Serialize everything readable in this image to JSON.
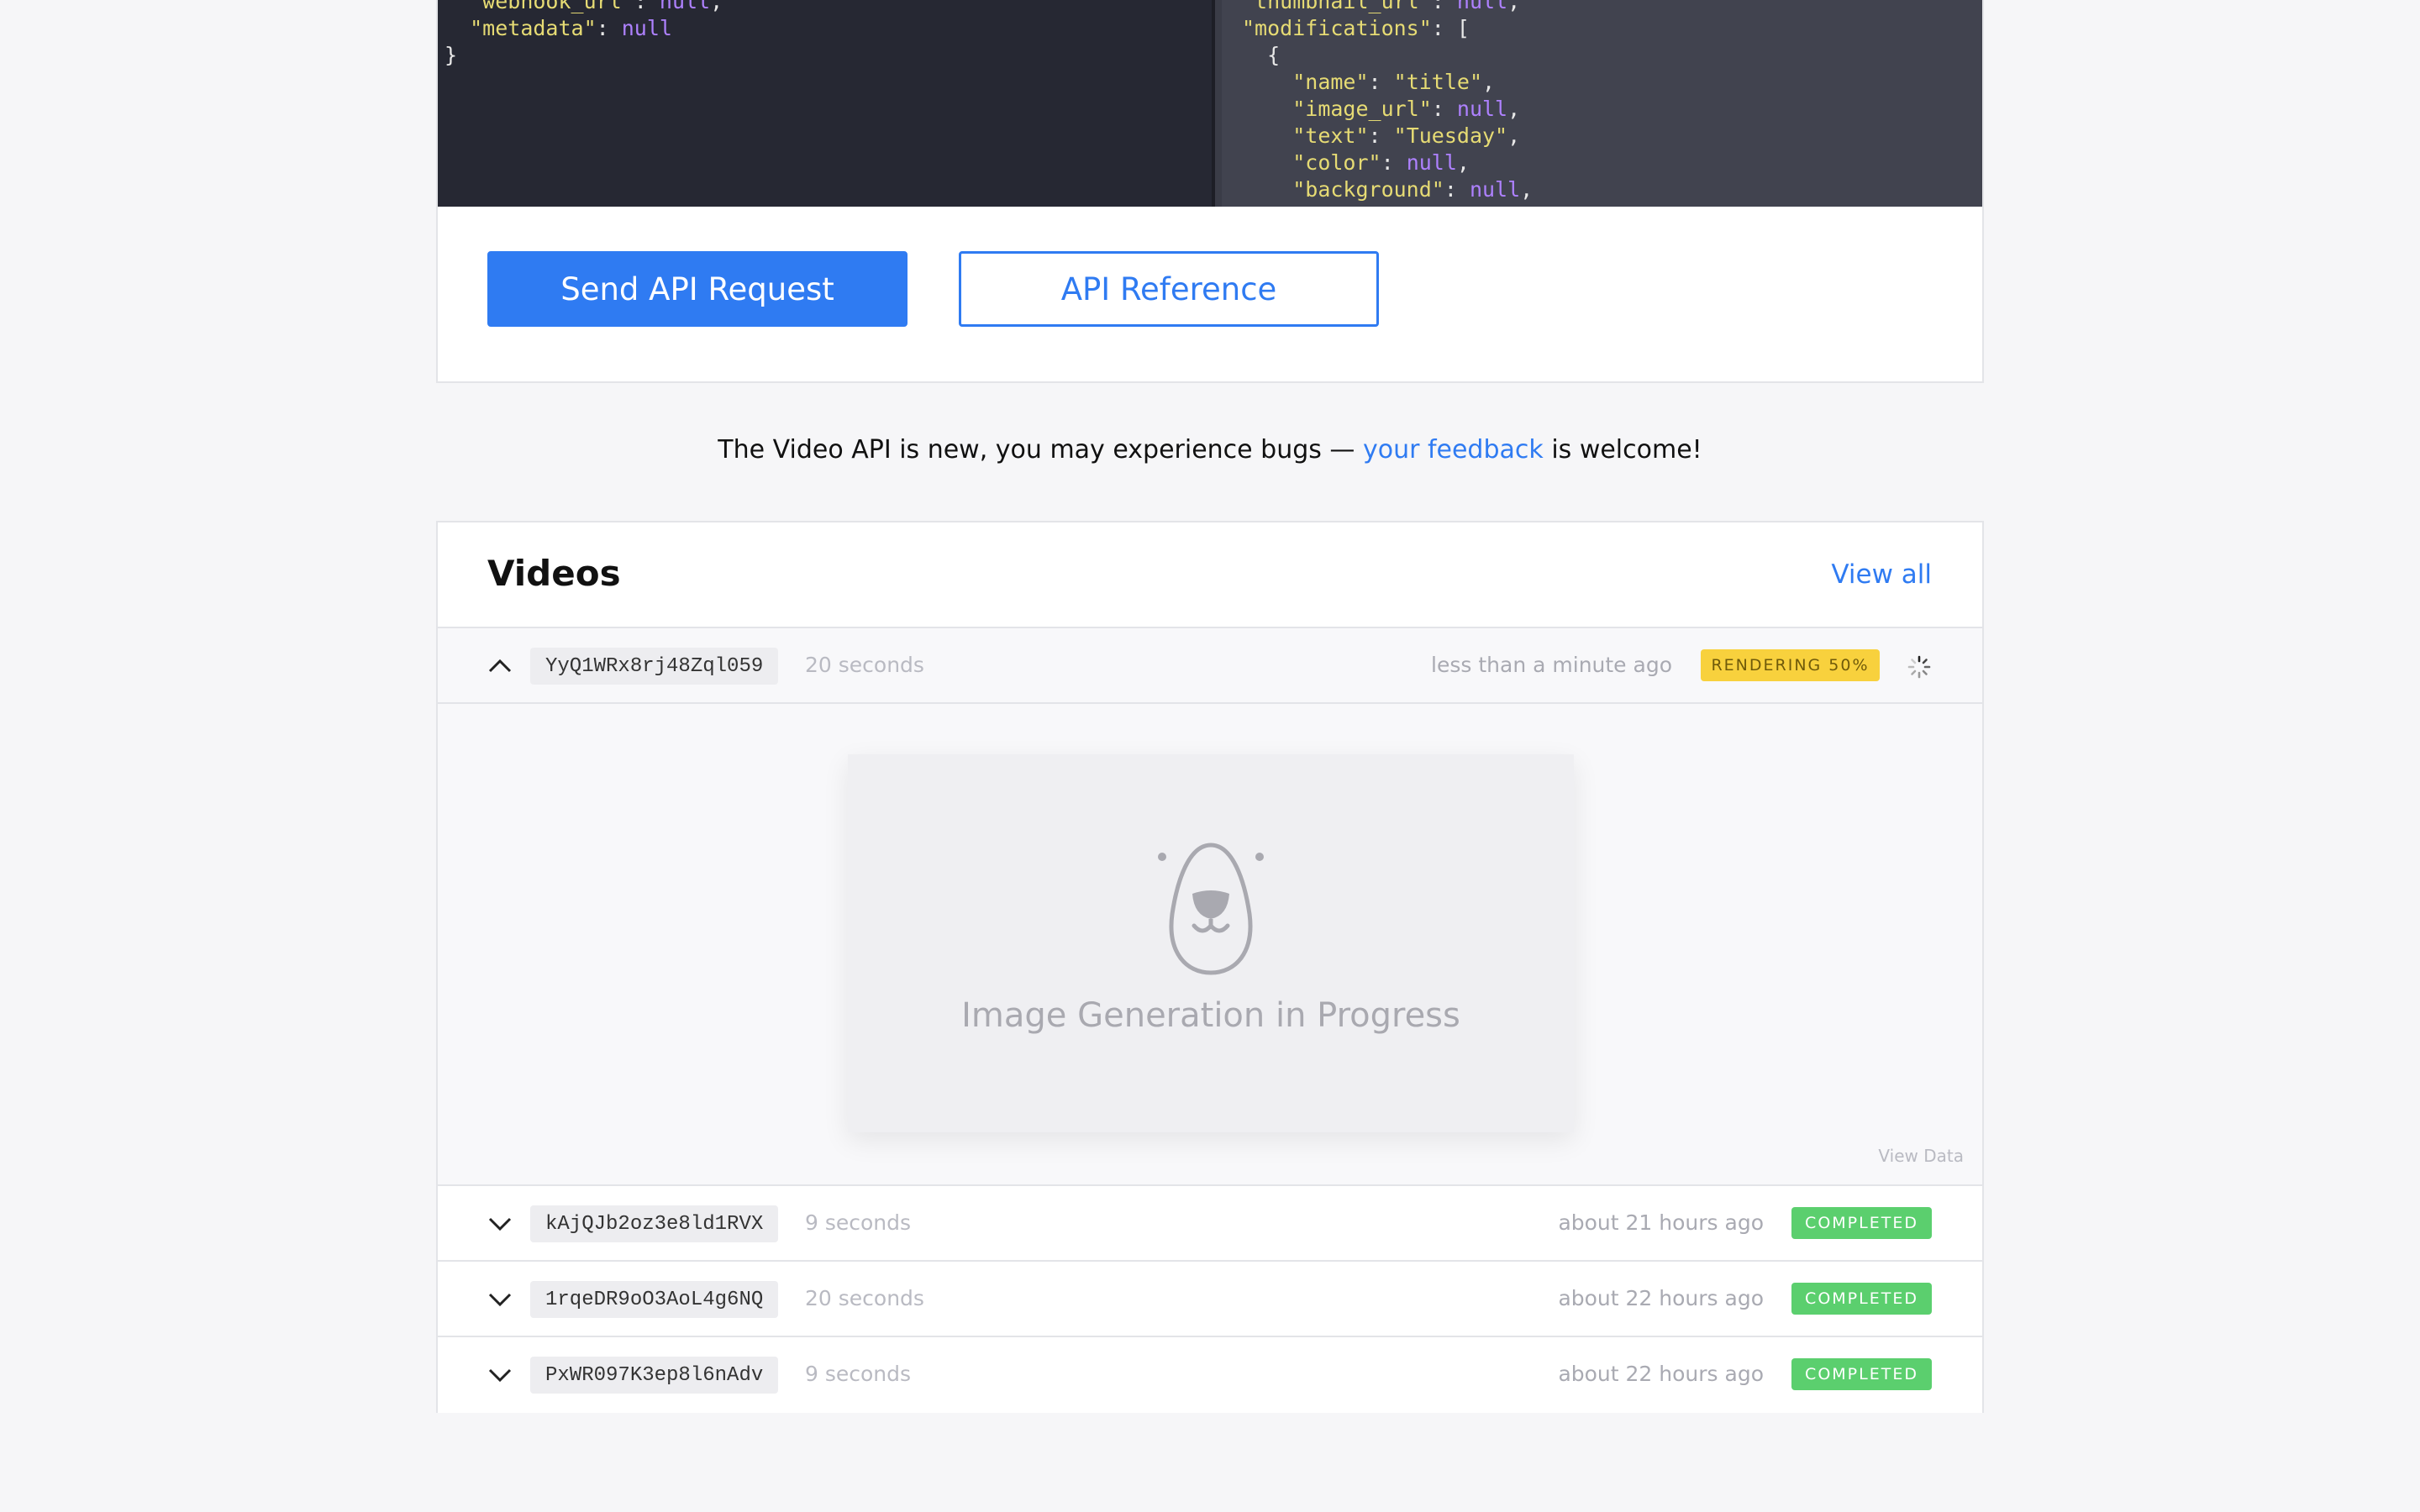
{
  "code_left": {
    "lines": [
      {
        "key": "\"webhook_url\"",
        "value": "null",
        "trail": ","
      },
      {
        "key": "\"metadata\"",
        "value": "null",
        "trail": ""
      }
    ],
    "closing": "}"
  },
  "code_right": {
    "line1": {
      "key": "\"thumbnail_url\"",
      "value": "null",
      "trail": ","
    },
    "line2": {
      "key": "\"modifications\"",
      "value": "[",
      "trail": ""
    },
    "open_brace": "{",
    "fields": [
      {
        "key": "\"name\"",
        "value": "\"title\"",
        "trail": ","
      },
      {
        "key": "\"image_url\"",
        "value": "null",
        "trail": ","
      },
      {
        "key": "\"text\"",
        "value": "\"Tuesday\"",
        "trail": ","
      },
      {
        "key": "\"color\"",
        "value": "null",
        "trail": ","
      },
      {
        "key": "\"background\"",
        "value": "null",
        "trail": ","
      }
    ]
  },
  "buttons": {
    "send": "Send API Request",
    "reference": "API Reference"
  },
  "notice": {
    "before": "The Video API is new, you may experience bugs — ",
    "link": "your feedback",
    "after": " is welcome!"
  },
  "videos": {
    "title": "Videos",
    "view_all": "View all",
    "rows": [
      {
        "id": "YyQ1WRx8rj48Zql059",
        "duration": "20 seconds",
        "ago": "less than a minute ago",
        "status": "RENDERING 50%",
        "progress": 0.5,
        "expanded": true
      },
      {
        "id": "kAjQJb2oz3e8ld1RVX",
        "duration": "9 seconds",
        "ago": "about 21 hours ago",
        "status": "COMPLETED",
        "expanded": false
      },
      {
        "id": "1rqeDR9oO3AoL4g6NQ",
        "duration": "20 seconds",
        "ago": "about 22 hours ago",
        "status": "COMPLETED",
        "expanded": false
      },
      {
        "id": "PxWR097K3ep8l6nAdv",
        "duration": "9 seconds",
        "ago": "about 22 hours ago",
        "status": "COMPLETED",
        "expanded": false
      }
    ],
    "placeholder_text": "Image Generation in Progress",
    "view_data": "View Data"
  },
  "icons": {
    "expanded_chevron": "chevron-up-icon",
    "collapsed_chevron": "chevron-down-icon",
    "spinner": "spinner-icon",
    "placeholder": "bear-face-icon"
  },
  "colors": {
    "accent": "#2f7bf2",
    "rendering": "#f8d13d",
    "completed": "#5bcf6e",
    "code_bg_left": "#262833",
    "code_bg_right": "#41434f"
  }
}
